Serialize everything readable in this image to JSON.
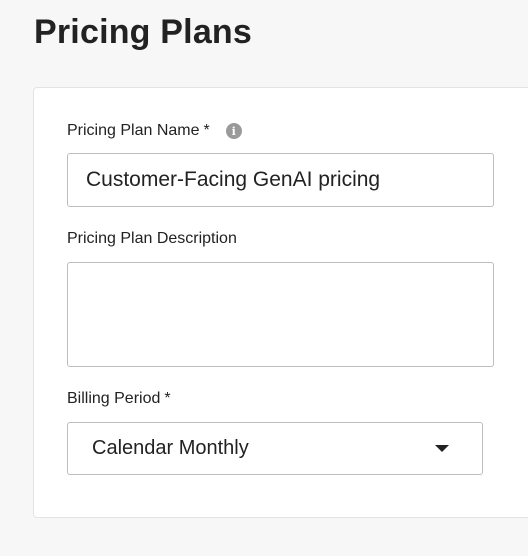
{
  "header": {
    "title": "Pricing Plans"
  },
  "form": {
    "name": {
      "label": "Pricing Plan Name",
      "required_marker": "*",
      "value": "Customer-Facing GenAI pricing",
      "info_icon": "info-icon"
    },
    "description": {
      "label": "Pricing Plan Description",
      "value": ""
    },
    "billing_period": {
      "label": "Billing Period",
      "required_marker": "*",
      "selected": "Calendar Monthly",
      "caret_icon": "caret-down-icon"
    }
  }
}
